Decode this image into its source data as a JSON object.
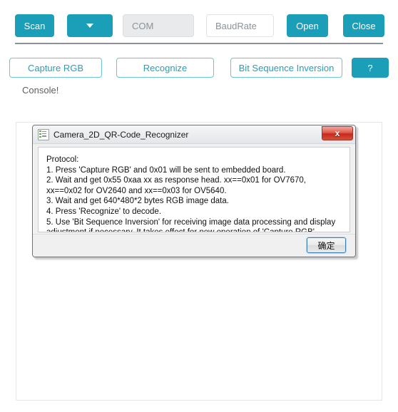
{
  "toolbar": {
    "scan_label": "Scan",
    "dropdown_icon": "chevron-down-icon",
    "com_placeholder": "COM",
    "com_value": "",
    "baudrate_placeholder": "BaudRate",
    "baudrate_value": "",
    "open_label": "Open",
    "close_label": "Close"
  },
  "actions": {
    "capture_rgb_label": "Capture RGB",
    "recognize_label": "Recognize",
    "bit_inversion_label": "Bit Sequence Inversion",
    "help_label": "?"
  },
  "console": {
    "label": "Console!",
    "content": ""
  },
  "dialog": {
    "title": "Camera_2D_QR-Code_Recognizer",
    "title_icon": "list-document-icon",
    "close_label": "x",
    "message": "Protocol:\n1. Press 'Capture RGB' and 0x01 will be sent to embedded board.\n2. Wait and get 0x55 0xaa xx as response head. xx==0x01 for OV7670, xx==0x02 for OV2640 and xx==0x03 for OV5640.\n3. Wait and get 640*480*2 bytes RGB image data.\n4. Press 'Recognize' to decode.\n5. Use 'Bit Sequence Inversion' for receiving image data processing and display adjustment if necessary. It takes effect for new operation of 'Capture RGB'.",
    "ok_label": "确定"
  },
  "colors": {
    "accent_teal": "#1b9eb7",
    "outline_teal": "#6fc4d3",
    "outline_text_teal": "#2b9db5",
    "close_red": "#c62a1a",
    "separator_gray": "#8d9196"
  }
}
